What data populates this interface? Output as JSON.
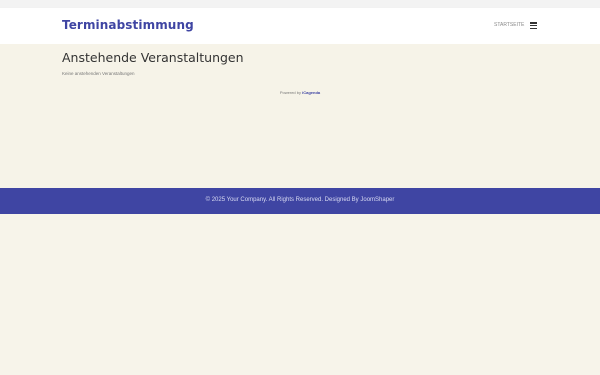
{
  "header": {
    "logo": "Terminabstimmung",
    "menu_link": "Startseite",
    "menu_icon": "hamburger-menu-icon"
  },
  "main": {
    "title": "Anstehende Veranstaltungen",
    "empty_message": "Keine anstehenden Veranstaltungen",
    "powered_prefix": "Powered by",
    "powered_link": "iCagenda"
  },
  "footer": {
    "copyright": "© 2025 Your Company. All Rights Reserved. Designed By JoomShaper"
  },
  "colors": {
    "accent": "#3f45a3",
    "background": "#f6f3e8",
    "header_bg": "#ffffff"
  }
}
